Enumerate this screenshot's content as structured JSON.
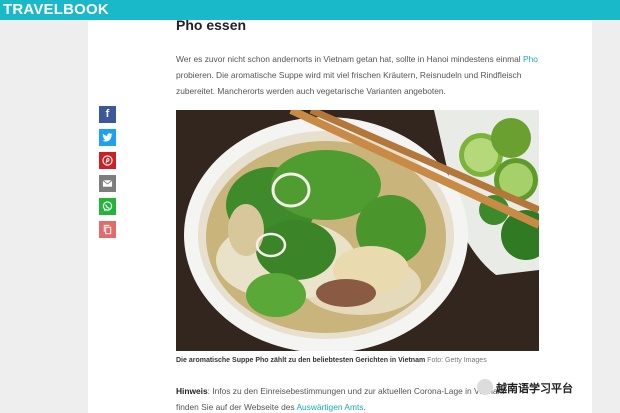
{
  "header": {
    "logo_text": "TRAVELBOOK"
  },
  "article": {
    "title": "Pho essen",
    "intro_part1": "Wer es zuvor nicht schon andernorts in Vietnam getan hat, sollte in Hanoi mindestens einmal ",
    "intro_link": "Pho",
    "intro_part2": " probieren. Die aromatische Suppe wird mit viel frischen Kräutern, Reisnudeln und Rindfleisch zubereitet. Mancherorts werden auch vegetarische Varianten angeboten.",
    "caption_bold": "Die aromatische Suppe Pho zählt zu den beliebtesten Gerichten in Vietnam",
    "caption_credit": " Foto: Getty Images",
    "note_label": "Hinweis",
    "note_part1": ": Infos zu den Einreisebestimmungen und zur aktuellen Corona-Lage in Vietnam",
    "note_part2": "finden Sie auf der Webseite des ",
    "note_link": "Auswärtigen Amts",
    "note_end": "."
  },
  "share_buttons": [
    {
      "icon": "facebook-icon",
      "color": "#3b5998"
    },
    {
      "icon": "twitter-icon",
      "color": "#1da1f2"
    },
    {
      "icon": "pinterest-icon",
      "color": "#cb2027"
    },
    {
      "icon": "email-icon",
      "color": "#7d7d7d"
    },
    {
      "icon": "whatsapp-icon",
      "color": "#25b33c"
    },
    {
      "icon": "copy-icon",
      "color": "#e56a6a"
    }
  ],
  "watermark": {
    "text": "越南语学习平台"
  },
  "colors": {
    "brand": "#19b9c9",
    "link": "#1ba9b8"
  }
}
